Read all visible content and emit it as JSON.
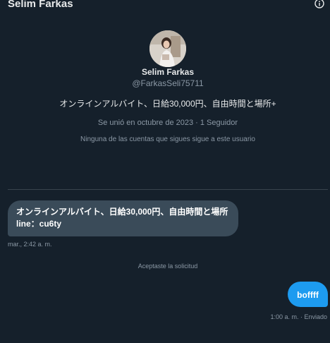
{
  "header": {
    "title": "Selim Farkas",
    "info_icon": "info-circle-icon"
  },
  "profile": {
    "display_name": "Selim Farkas",
    "handle": "@FarkasSeli75711",
    "bio": "オンラインアルバイト、日給30,000円、自由時間と場所+",
    "joined": "Se unió en octubre de 2023 · 1 Seguidor",
    "followers_note": "Ninguna de las cuentas que sigues sigue a este usuario"
  },
  "messages": [
    {
      "direction": "incoming",
      "text": "オンラインアルバイト、日給30,000円、自由時間と場所 line：cu6ty",
      "timestamp": "mar., 2:42 a. m."
    },
    {
      "direction": "outgoing",
      "text": "boffff",
      "timestamp": "1:00 a. m. · Enviado"
    }
  ],
  "system_note": "Aceptaste la solicitud",
  "colors": {
    "background": "#15202b",
    "incoming_bubble": "#3a4b59",
    "outgoing_bubble": "#1d9bf0",
    "muted_text": "#8b98a5"
  }
}
